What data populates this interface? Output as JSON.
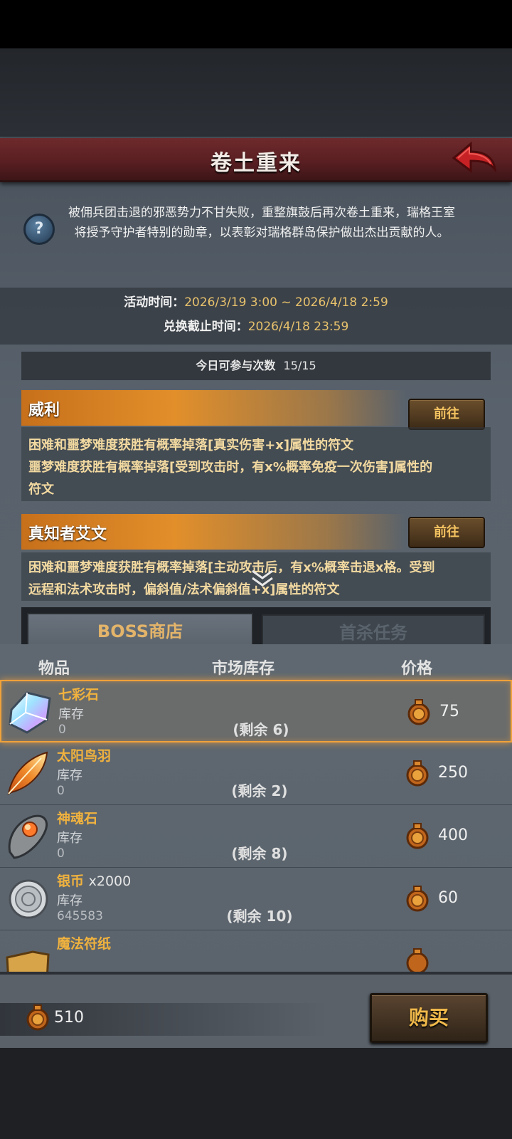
{
  "title": "卷土重来",
  "description": "被佣兵团击退的邪恶势力不甘失败，重整旗鼓后再次卷土重来，瑞格王室将授予守护者特别的勋章，以表彰对瑞格群岛保护做出杰出贡献的人。",
  "activity_time": {
    "label": "活动时间：",
    "value": "2026/3/19 3:00 ~ 2026/4/18 2:59"
  },
  "exchange_deadline": {
    "label": "兑换截止时间：",
    "value": "2026/4/18 23:59"
  },
  "daily_count": {
    "label": "今日可参与次数",
    "value": "15/15"
  },
  "bosses": [
    {
      "name": "威利",
      "button": "前往",
      "drops": [
        "困难和噩梦难度获胜有概率掉落[真实伤害+x]属性的符文",
        "噩梦难度获胜有概率掉落[受到攻击时，有x%概率免疫一次伤害]属性的",
        "符文"
      ]
    },
    {
      "name": "真知者艾文",
      "button": "前往",
      "drops": [
        "困难和噩梦难度获胜有概率掉落[主动攻击后，有x%概率击退x格。受到",
        "远程和法术攻击时，偏斜值/法术偏斜值+x]属性的符文"
      ]
    }
  ],
  "tabs": [
    {
      "label": "BOSS商店",
      "active": true
    },
    {
      "label": "首杀任务",
      "active": false
    }
  ],
  "table_headers": {
    "item": "物品",
    "stock": "市场库存",
    "price": "价格"
  },
  "items": [
    {
      "name": "七彩石",
      "qty": "",
      "stock_label": "库存",
      "stock": "0",
      "remain": "(剩余 6)",
      "price": "75",
      "icon": "rainbow-crystal-icon"
    },
    {
      "name": "太阳鸟羽",
      "qty": "",
      "stock_label": "库存",
      "stock": "0",
      "remain": "(剩余 2)",
      "price": "250",
      "icon": "sunbird-feather-icon"
    },
    {
      "name": "神魂石",
      "qty": "",
      "stock_label": "库存",
      "stock": "0",
      "remain": "(剩余 8)",
      "price": "400",
      "icon": "soul-stone-icon"
    },
    {
      "name": "银币",
      "qty": "x2000",
      "stock_label": "库存",
      "stock": "645583",
      "remain": "(剩余 10)",
      "price": "60",
      "icon": "silver-coin-icon"
    },
    {
      "name": "魔法符纸",
      "qty": "",
      "stock_label": "",
      "stock": "",
      "remain": "",
      "price": "",
      "icon": "magic-paper-icon"
    }
  ],
  "balance": "510",
  "buy_button": "购买",
  "colors": {
    "accent_gold": "#e8c26c",
    "title_bar": "#5a1f22",
    "selected_border": "#f0a23a"
  }
}
